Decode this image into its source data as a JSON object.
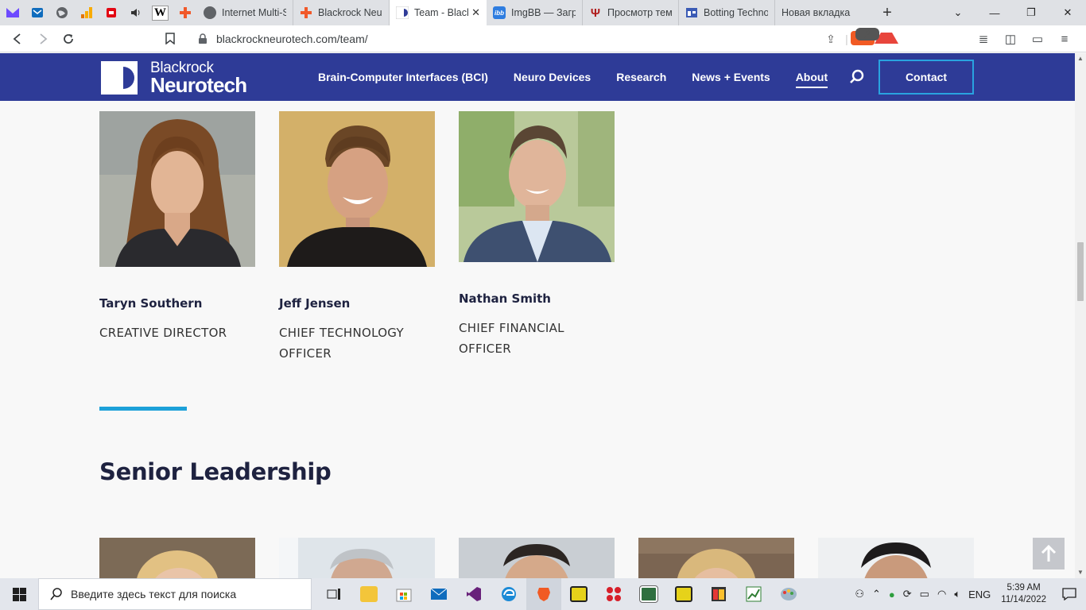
{
  "browser": {
    "pinned_tabs": [
      {
        "icon": "proton-mail-icon",
        "color": "#6d4aff"
      },
      {
        "icon": "mail-icon",
        "color": "#0f6cbd"
      },
      {
        "icon": "globe-icon",
        "color": "#555555"
      },
      {
        "icon": "analytics-icon",
        "color": "#f9ab00"
      },
      {
        "icon": "bank-icon",
        "color": "#e30613"
      },
      {
        "icon": "speaker-icon",
        "color": "#333333"
      },
      {
        "icon": "wikipedia-icon",
        "color": "#000000",
        "glyph": "W"
      },
      {
        "icon": "plus-cross-icon",
        "color": "#f1592a"
      }
    ],
    "tabs": [
      {
        "title": "Internet Multi-S",
        "icon": "globe-icon",
        "color": "#606367"
      },
      {
        "title": "Blackrock Neuro",
        "icon": "plus-cross-icon",
        "color": "#f1592a"
      },
      {
        "title": "Team - Black",
        "icon": "blackrock-icon",
        "color": "#ffffff",
        "active": true
      },
      {
        "title": "ImgBB — Загру",
        "icon": "imgbb-icon",
        "color": "#2e7de0",
        "glyph": "ibb"
      },
      {
        "title": "Просмотр тема",
        "icon": "psi-icon",
        "color": "#b01b1b",
        "glyph": "Ψ"
      },
      {
        "title": "Botting Technol",
        "icon": "window-icon",
        "color": "#3b5bb5"
      },
      {
        "title": "Новая вкладка",
        "icon": "none",
        "color": "#dfe1e5"
      }
    ],
    "url": "blackrockneurotech.com/team/",
    "brave_badge": "2"
  },
  "site": {
    "logo_line1": "Blackrock",
    "logo_line2": "Neurotech",
    "nav": [
      {
        "label": "Brain-Computer Interfaces (BCI)"
      },
      {
        "label": "Neuro Devices"
      },
      {
        "label": "Research"
      },
      {
        "label": "News + Events"
      },
      {
        "label": "About",
        "active": true
      }
    ],
    "contact_label": "Contact",
    "brand_color": "#2e3b97",
    "accent_color": "#1da1d9"
  },
  "team": [
    {
      "name": "Taryn Southern",
      "role": "CREATIVE DIRECTOR"
    },
    {
      "name": "Jeff Jensen",
      "role": "CHIEF TECHNOLOGY OFFICER"
    },
    {
      "name": "Nathan Smith",
      "role": "CHIEF FINANCIAL OFFICER"
    }
  ],
  "senior_leadership": {
    "title": "Senior Leadership"
  },
  "taskbar": {
    "search_placeholder": "Введите здесь текст для поиска",
    "language": "ENG",
    "time": "5:39 AM",
    "date": "11/14/2022"
  }
}
